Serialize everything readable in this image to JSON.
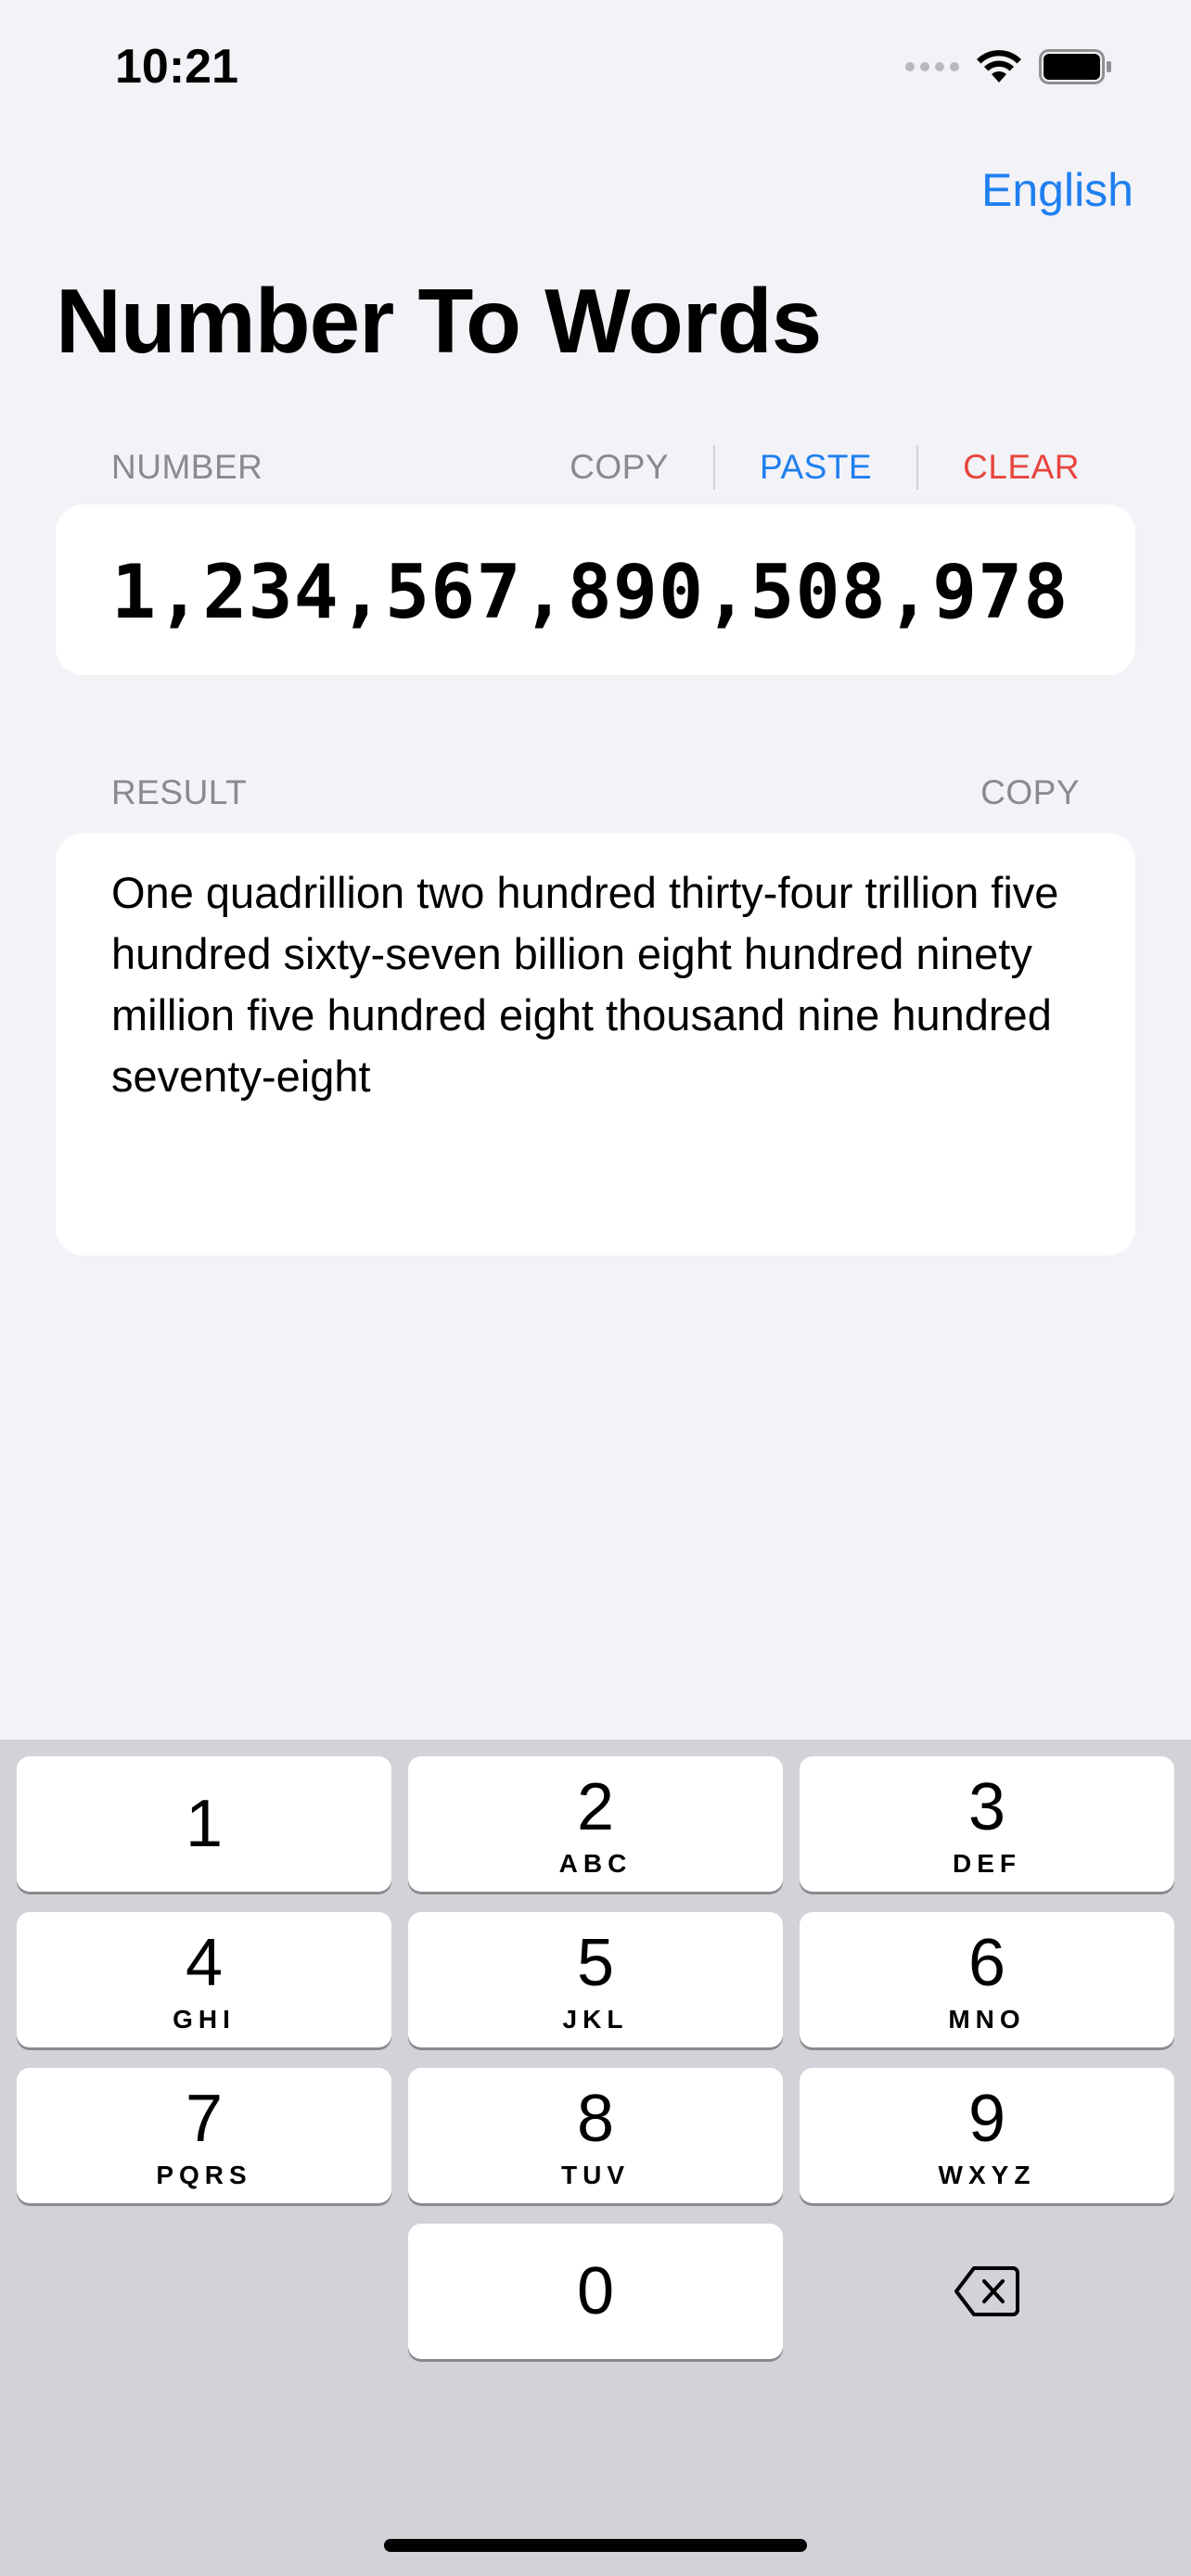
{
  "status_bar": {
    "time": "10:21",
    "icons": [
      "cellular-signal-icon",
      "wifi-icon",
      "battery-icon"
    ]
  },
  "header": {
    "language_label": "English",
    "title": "Number To Words"
  },
  "number_section": {
    "label": "NUMBER",
    "copy_label": "COPY",
    "paste_label": "PASTE",
    "clear_label": "CLEAR",
    "value": "1,234,567,890,508,978"
  },
  "result_section": {
    "label": "RESULT",
    "copy_label": "COPY",
    "text": "One quadrillion two hundred thirty-four trillion five hundred sixty-seven billion eight hundred ninety million five hundred eight thousand nine hundred seventy-eight"
  },
  "keypad": {
    "keys": [
      {
        "digit": "1",
        "letters": ""
      },
      {
        "digit": "2",
        "letters": "ABC"
      },
      {
        "digit": "3",
        "letters": "DEF"
      },
      {
        "digit": "4",
        "letters": "GHI"
      },
      {
        "digit": "5",
        "letters": "JKL"
      },
      {
        "digit": "6",
        "letters": "MNO"
      },
      {
        "digit": "7",
        "letters": "PQRS"
      },
      {
        "digit": "8",
        "letters": "TUV"
      },
      {
        "digit": "9",
        "letters": "WXYZ"
      },
      {
        "digit": "0",
        "letters": ""
      }
    ],
    "delete_icon": "delete-backspace-icon"
  },
  "colors": {
    "accent_blue": "#1f7ff0",
    "destructive_red": "#e8453c",
    "secondary_gray": "#8a8a8e",
    "background": "#f2f2f7",
    "keypad_background": "#d1d3d9"
  }
}
